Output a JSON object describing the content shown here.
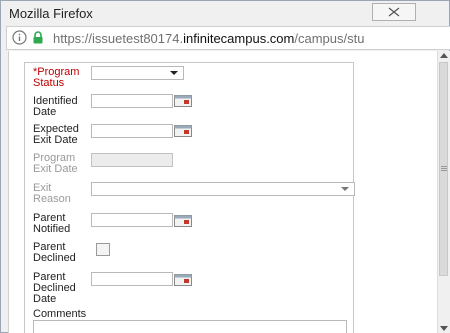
{
  "window": {
    "title": "Mozilla Firefox",
    "url_prefix": "https://issuetest80174.",
    "url_domain": "infinitecampus.com",
    "url_path": "/campus/stu"
  },
  "form": {
    "program_status": {
      "label_line1": "*Program",
      "label_line2": "Status",
      "value": ""
    },
    "identified_date": {
      "label_line1": "Identified",
      "label_line2": "Date",
      "value": ""
    },
    "expected_exit_date": {
      "label_line1": "Expected",
      "label_line2": "Exit Date",
      "value": ""
    },
    "program_exit_date": {
      "label_line1": "Program",
      "label_line2": "Exit Date",
      "value": ""
    },
    "exit_reason": {
      "label_line1": "Exit",
      "label_line2": "Reason",
      "value": ""
    },
    "parent_notified": {
      "label_line1": "Parent",
      "label_line2": "Notified",
      "value": ""
    },
    "parent_declined": {
      "label_line1": "Parent",
      "label_line2": "Declined",
      "checked": false
    },
    "parent_declined_date": {
      "label_line1": "Parent",
      "label_line2": "Declined",
      "label_line3": "Date",
      "value": ""
    },
    "comments": {
      "label": "Comments",
      "value": ""
    }
  },
  "colors": {
    "required_label": "#c00000",
    "disabled_label": "#9a9a9a",
    "calendar_accent": "#c0392b"
  },
  "icons": [
    "info-icon",
    "lock-icon",
    "close-icon",
    "calendar-icon"
  ]
}
